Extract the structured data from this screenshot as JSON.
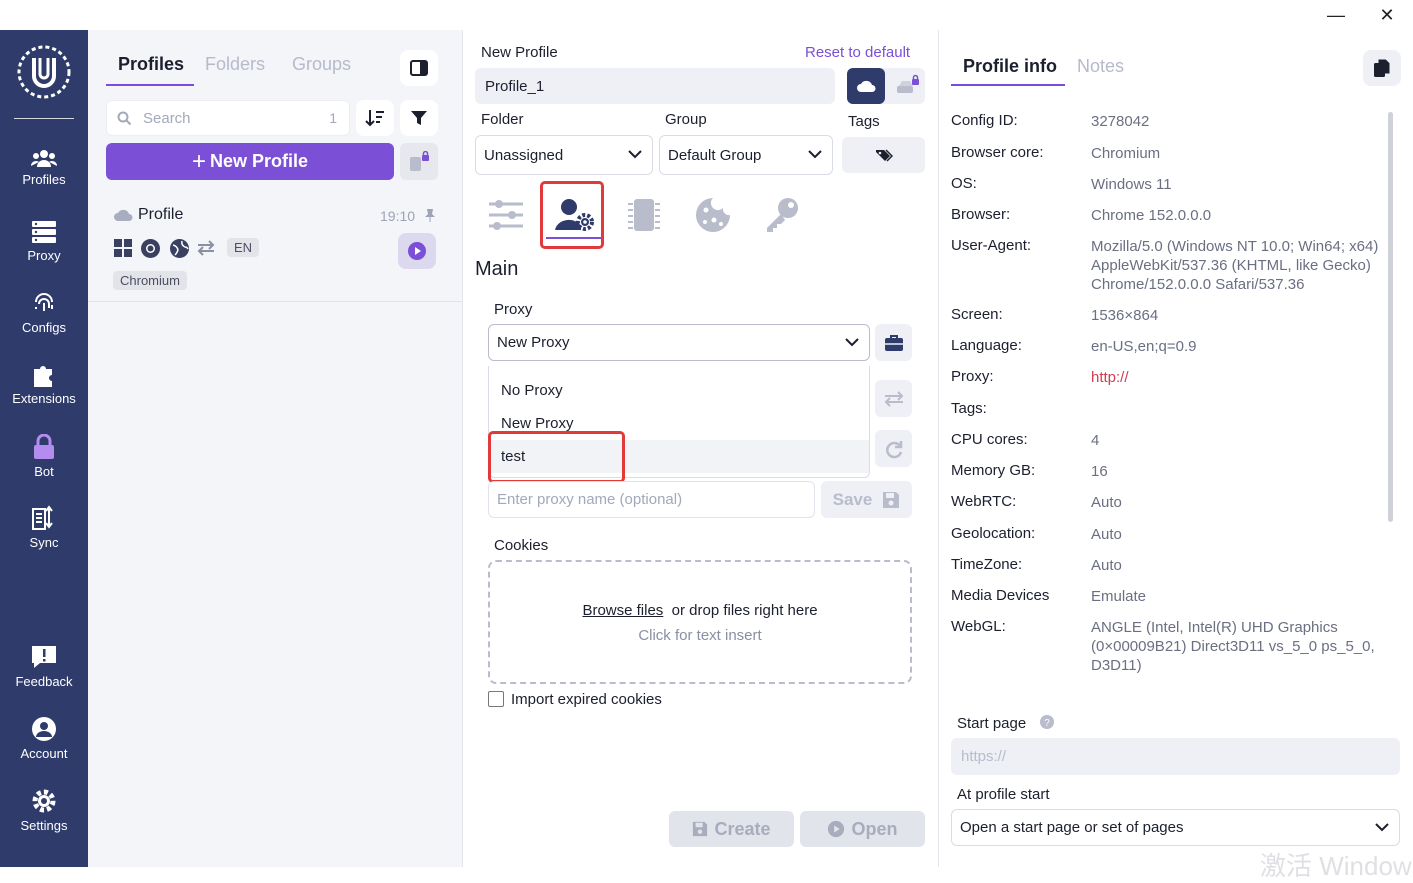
{
  "window": {
    "minimize": "—",
    "close": "✕"
  },
  "nav": {
    "items": [
      {
        "label": "Profiles"
      },
      {
        "label": "Proxy"
      },
      {
        "label": "Configs"
      },
      {
        "label": "Extensions"
      },
      {
        "label": "Bot"
      },
      {
        "label": "Sync"
      },
      {
        "label": "Feedback"
      },
      {
        "label": "Account"
      },
      {
        "label": "Settings"
      }
    ]
  },
  "list": {
    "tabs": [
      "Profiles",
      "Folders",
      "Groups"
    ],
    "active_tab": "Profiles",
    "search_placeholder": "Search",
    "search_count": "1",
    "new_profile_label": "New Profile",
    "profile": {
      "name": "Profile",
      "time": "19:10",
      "lang": "EN",
      "core": "Chromium"
    }
  },
  "form": {
    "title": "New Profile",
    "reset_label": "Reset to default",
    "name_value": "Profile_1",
    "folder_label": "Folder",
    "folder_value": "Unassigned",
    "group_label": "Group",
    "group_value": "Default Group",
    "tags_label": "Tags",
    "section_title": "Main",
    "proxy_label": "Proxy",
    "proxy_value": "New Proxy",
    "proxy_options": [
      "No Proxy",
      "New Proxy",
      "test"
    ],
    "proxy_hovered_option": "test",
    "proxy_name_placeholder": "Enter proxy name (optional)",
    "save_label": "Save",
    "cookies_label": "Cookies",
    "browse_files": "Browse files",
    "drop_text": "or drop files right here",
    "text_insert": "Click for text insert",
    "import_expired": "Import expired cookies",
    "import_expired_checked": false,
    "create_label": "Create",
    "open_label": "Open"
  },
  "info": {
    "tabs": [
      "Profile info",
      "Notes"
    ],
    "active_tab": "Profile info",
    "rows": [
      {
        "key": "Config ID:",
        "value": "3278042"
      },
      {
        "key": "Browser core:",
        "value": "Chromium"
      },
      {
        "key": "OS:",
        "value": "Windows 11"
      },
      {
        "key": "Browser:",
        "value": "Chrome 152.0.0.0"
      },
      {
        "key": "User-Agent:",
        "value": "Mozilla/5.0 (Windows NT 10.0; Win64; x64) AppleWebKit/537.36 (KHTML, like Gecko) Chrome/152.0.0.0 Safari/537.36"
      },
      {
        "key": "Screen:",
        "value": "1536×864"
      },
      {
        "key": "Language:",
        "value": "en-US,en;q=0.9"
      },
      {
        "key": "Proxy:",
        "value": "http://"
      },
      {
        "key": "Tags:",
        "value": ""
      },
      {
        "key": "CPU cores:",
        "value": "4"
      },
      {
        "key": "Memory GB:",
        "value": "16"
      },
      {
        "key": "WebRTC:",
        "value": "Auto"
      },
      {
        "key": "Geolocation:",
        "value": "Auto"
      },
      {
        "key": "TimeZone:",
        "value": "Auto"
      },
      {
        "key": "Media Devices",
        "value": "Emulate"
      },
      {
        "key": "WebGL:",
        "value": "ANGLE (Intel, Intel(R) UHD Graphics (0×00009B21) Direct3D11 vs_5_0 ps_5_0, D3D11)"
      }
    ],
    "start_page_label": "Start page",
    "start_page_placeholder": "https://",
    "at_start_label": "At profile start",
    "at_start_value": "Open a start page or set of pages"
  },
  "watermark": "激活 Windows",
  "colors": {
    "accent": "#7b4fd6",
    "nav_bg": "#2f3b6a",
    "highlight": "#e23a3a",
    "proxy_value": "#d33a4f"
  }
}
